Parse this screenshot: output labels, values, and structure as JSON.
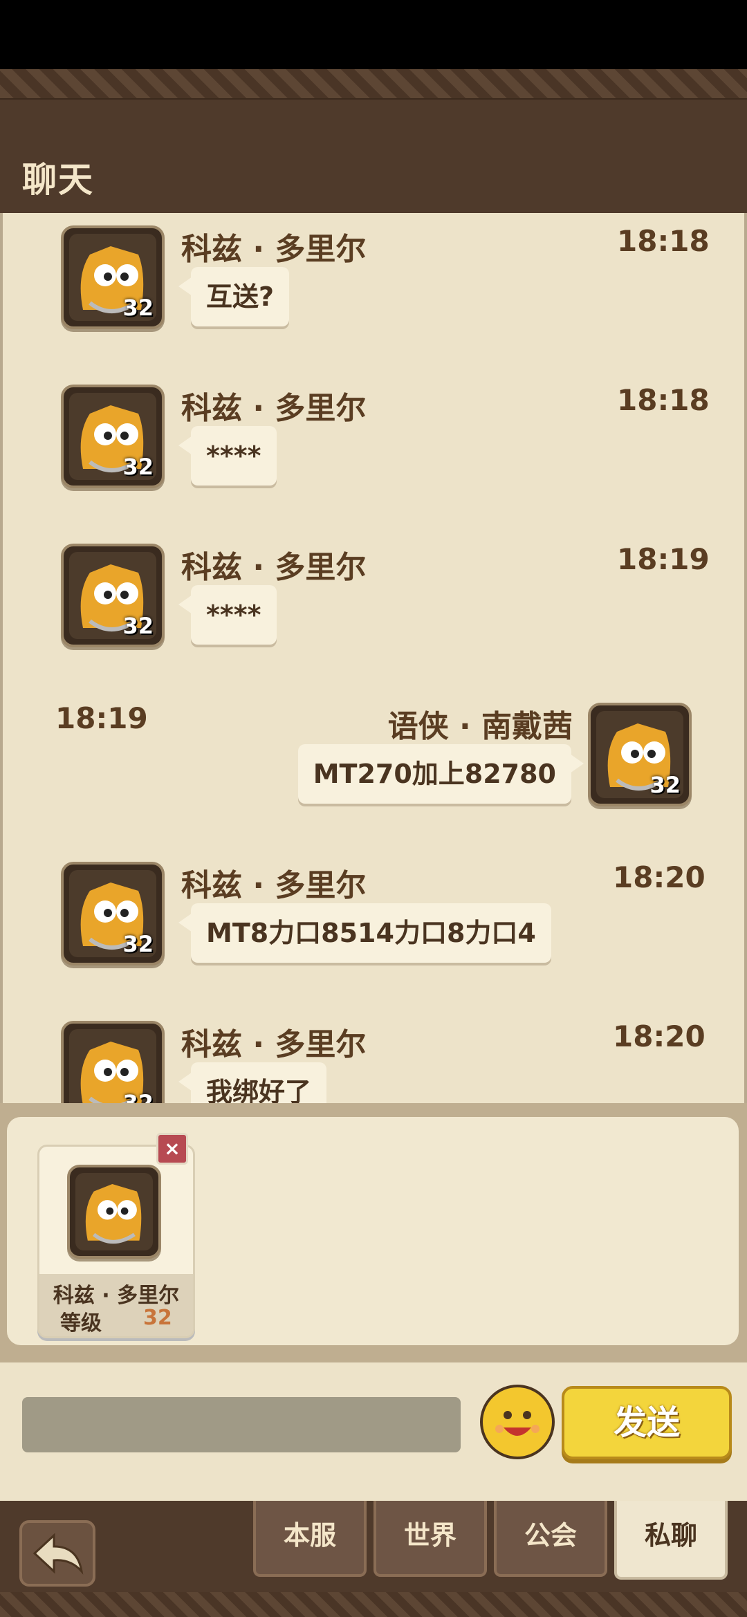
{
  "header": {
    "title": "聊天"
  },
  "messages": [
    {
      "sender": "科兹 · 多里尔",
      "time": "18:18",
      "text": "互送?",
      "level": "32",
      "side": "left"
    },
    {
      "sender": "科兹 · 多里尔",
      "time": "18:18",
      "text": "****",
      "level": "32",
      "side": "left"
    },
    {
      "sender": "科兹 · 多里尔",
      "time": "18:19",
      "text": "****",
      "level": "32",
      "side": "left"
    },
    {
      "sender": "语侠 · 南戴茜",
      "time": "18:19",
      "text": "MT270加上82780",
      "level": "32",
      "side": "right"
    },
    {
      "sender": "科兹 · 多里尔",
      "time": "18:20",
      "text": "MT8力口8514力口8力口4",
      "level": "32",
      "side": "left"
    },
    {
      "sender": "科兹 · 多里尔",
      "time": "18:20",
      "text": "我绑好了",
      "level": "32",
      "side": "left"
    }
  ],
  "contact": {
    "name": "科兹 · 多里尔",
    "level_label": "等级",
    "level": "32",
    "close": "×"
  },
  "input": {
    "placeholder": ""
  },
  "send_label": "发送",
  "tabs": [
    "本服",
    "世界",
    "公会",
    "私聊"
  ],
  "colors": {
    "header_bg": "#4f3a2b",
    "chat_bg": "#ede3c9",
    "send_bg": "#f3d53c",
    "bubble_bg": "#f8f1dd"
  },
  "icons": {
    "emoji": "smiley-face-icon",
    "back": "back-arrow-icon",
    "avatar": "yellow-creature-avatar"
  }
}
